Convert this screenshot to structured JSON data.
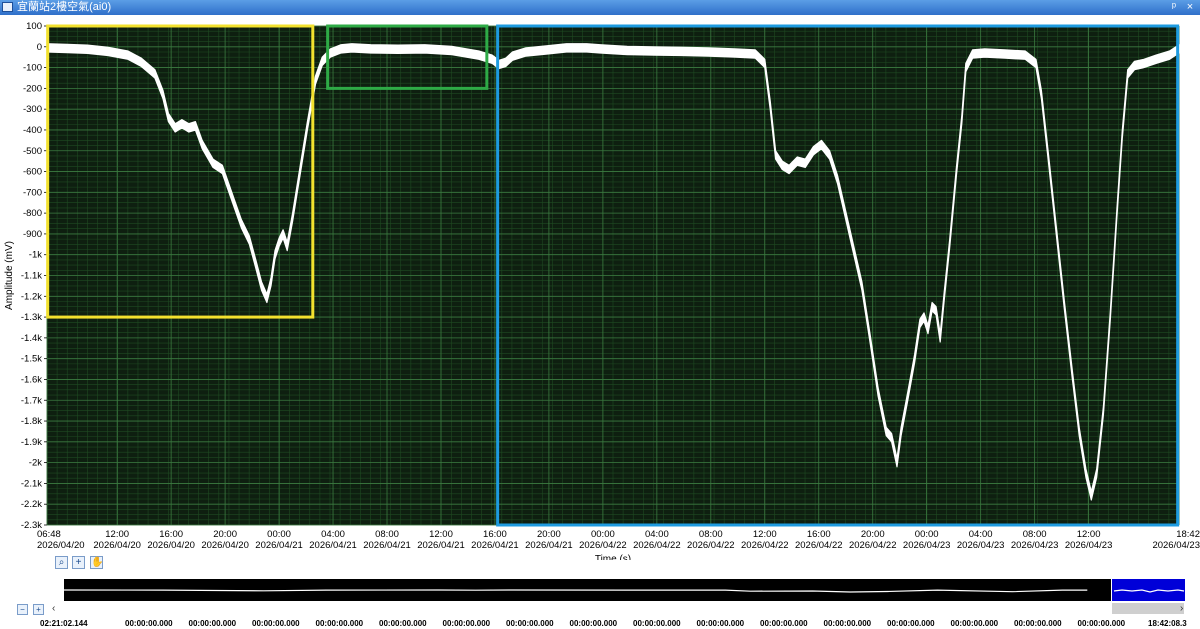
{
  "window": {
    "title": "宜蘭站2樓空氣(ai0)",
    "buttons": [
      "ᵖ",
      "×"
    ]
  },
  "chart_data": {
    "type": "line",
    "ylabel": "Amplitude (mV)",
    "xlabel": "Time (s)",
    "ylim": [
      -2300,
      100
    ],
    "yticks": [
      {
        "v": 100,
        "label": "100"
      },
      {
        "v": 0,
        "label": "0"
      },
      {
        "v": -100,
        "label": "-100"
      },
      {
        "v": -200,
        "label": "-200"
      },
      {
        "v": -300,
        "label": "-300"
      },
      {
        "v": -400,
        "label": "-400"
      },
      {
        "v": -500,
        "label": "-500"
      },
      {
        "v": -600,
        "label": "-600"
      },
      {
        "v": -700,
        "label": "-700"
      },
      {
        "v": -800,
        "label": "-800"
      },
      {
        "v": -900,
        "label": "-900"
      },
      {
        "v": -1000,
        "label": "-1k"
      },
      {
        "v": -1100,
        "label": "-1.1k"
      },
      {
        "v": -1200,
        "label": "-1.2k"
      },
      {
        "v": -1300,
        "label": "-1.3k"
      },
      {
        "v": -1400,
        "label": "-1.4k"
      },
      {
        "v": -1500,
        "label": "-1.5k"
      },
      {
        "v": -1600,
        "label": "-1.6k"
      },
      {
        "v": -1700,
        "label": "-1.7k"
      },
      {
        "v": -1800,
        "label": "-1.8k"
      },
      {
        "v": -1900,
        "label": "-1.9k"
      },
      {
        "v": -2000,
        "label": "-2k"
      },
      {
        "v": -2100,
        "label": "-2.1k"
      },
      {
        "v": -2200,
        "label": "-2.2k"
      },
      {
        "v": -2300,
        "label": "-2.3k"
      }
    ],
    "xlim_hours": [
      0,
      83.9
    ],
    "xticks": [
      {
        "h": 0,
        "time": "06:48",
        "date": "2026/04/20"
      },
      {
        "h": 5.2,
        "time": "12:00",
        "date": "2026/04/20"
      },
      {
        "h": 9.2,
        "time": "16:00",
        "date": "2026/04/20"
      },
      {
        "h": 13.2,
        "time": "20:00",
        "date": "2026/04/20"
      },
      {
        "h": 17.2,
        "time": "00:00",
        "date": "2026/04/21"
      },
      {
        "h": 21.2,
        "time": "04:00",
        "date": "2026/04/21"
      },
      {
        "h": 25.2,
        "time": "08:00",
        "date": "2026/04/21"
      },
      {
        "h": 29.2,
        "time": "12:00",
        "date": "2026/04/21"
      },
      {
        "h": 33.2,
        "time": "16:00",
        "date": "2026/04/21"
      },
      {
        "h": 37.2,
        "time": "20:00",
        "date": "2026/04/21"
      },
      {
        "h": 41.2,
        "time": "00:00",
        "date": "2026/04/22"
      },
      {
        "h": 45.2,
        "time": "04:00",
        "date": "2026/04/22"
      },
      {
        "h": 49.2,
        "time": "08:00",
        "date": "2026/04/22"
      },
      {
        "h": 53.2,
        "time": "12:00",
        "date": "2026/04/22"
      },
      {
        "h": 57.2,
        "time": "16:00",
        "date": "2026/04/22"
      },
      {
        "h": 61.2,
        "time": "20:00",
        "date": "2026/04/22"
      },
      {
        "h": 65.2,
        "time": "00:00",
        "date": "2026/04/23"
      },
      {
        "h": 69.2,
        "time": "04:00",
        "date": "2026/04/23"
      },
      {
        "h": 73.2,
        "time": "08:00",
        "date": "2026/04/23"
      },
      {
        "h": 77.2,
        "time": "12:00",
        "date": "2026/04/23"
      },
      {
        "h": 83.9,
        "time": "18:42",
        "date": "2026/04/23"
      }
    ],
    "series": [
      {
        "color": "#ffffff",
        "band_mv": 40,
        "points": [
          [
            0,
            -5
          ],
          [
            1.5,
            -8
          ],
          [
            3,
            -12
          ],
          [
            4.5,
            -22
          ],
          [
            6,
            -40
          ],
          [
            7,
            -75
          ],
          [
            8,
            -130
          ],
          [
            8.6,
            -230
          ],
          [
            9,
            -340
          ],
          [
            9.5,
            -390
          ],
          [
            10,
            -370
          ],
          [
            10.5,
            -390
          ],
          [
            11,
            -380
          ],
          [
            11.5,
            -470
          ],
          [
            12.3,
            -560
          ],
          [
            13,
            -590
          ],
          [
            13.7,
            -720
          ],
          [
            14.4,
            -850
          ],
          [
            15,
            -930
          ],
          [
            15.5,
            -1050
          ],
          [
            15.9,
            -1150
          ],
          [
            16.3,
            -1210
          ],
          [
            16.6,
            -1130
          ],
          [
            16.9,
            -1000
          ],
          [
            17.2,
            -940
          ],
          [
            17.5,
            -900
          ],
          [
            17.8,
            -960
          ],
          [
            18.2,
            -820
          ],
          [
            18.7,
            -620
          ],
          [
            19.3,
            -380
          ],
          [
            19.9,
            -160
          ],
          [
            20.4,
            -70
          ],
          [
            21,
            -30
          ],
          [
            21.8,
            -10
          ],
          [
            22.6,
            -5
          ],
          [
            24,
            -10
          ],
          [
            26,
            -12
          ],
          [
            28,
            -10
          ],
          [
            30,
            -18
          ],
          [
            32,
            -40
          ],
          [
            33,
            -60
          ],
          [
            33.5,
            -85
          ],
          [
            34,
            -75
          ],
          [
            34.5,
            -45
          ],
          [
            35.5,
            -25
          ],
          [
            37,
            -15
          ],
          [
            38.5,
            -5
          ],
          [
            40,
            -5
          ],
          [
            41,
            -10
          ],
          [
            43,
            -18
          ],
          [
            45,
            -20
          ],
          [
            47,
            -22
          ],
          [
            49,
            -25
          ],
          [
            51,
            -30
          ],
          [
            52.5,
            -35
          ],
          [
            53.2,
            -80
          ],
          [
            53.6,
            -280
          ],
          [
            54,
            -520
          ],
          [
            54.5,
            -570
          ],
          [
            55,
            -590
          ],
          [
            55.6,
            -550
          ],
          [
            56.2,
            -560
          ],
          [
            56.8,
            -500
          ],
          [
            57.4,
            -470
          ],
          [
            58,
            -520
          ],
          [
            58.6,
            -640
          ],
          [
            59.2,
            -810
          ],
          [
            59.8,
            -980
          ],
          [
            60.4,
            -1150
          ],
          [
            61,
            -1400
          ],
          [
            61.6,
            -1660
          ],
          [
            62.2,
            -1850
          ],
          [
            62.6,
            -1880
          ],
          [
            63,
            -2000
          ],
          [
            63.3,
            -1850
          ],
          [
            63.8,
            -1680
          ],
          [
            64.3,
            -1500
          ],
          [
            64.7,
            -1330
          ],
          [
            65,
            -1300
          ],
          [
            65.3,
            -1360
          ],
          [
            65.6,
            -1250
          ],
          [
            65.9,
            -1270
          ],
          [
            66.2,
            -1400
          ],
          [
            66.5,
            -1200
          ],
          [
            66.9,
            -950
          ],
          [
            67.4,
            -600
          ],
          [
            67.8,
            -350
          ],
          [
            68.1,
            -100
          ],
          [
            68.6,
            -35
          ],
          [
            69.5,
            -30
          ],
          [
            71,
            -35
          ],
          [
            72.5,
            -40
          ],
          [
            73.3,
            -80
          ],
          [
            73.7,
            -230
          ],
          [
            74.2,
            -520
          ],
          [
            74.8,
            -880
          ],
          [
            75.4,
            -1240
          ],
          [
            76,
            -1580
          ],
          [
            76.5,
            -1850
          ],
          [
            77,
            -2050
          ],
          [
            77.4,
            -2160
          ],
          [
            77.8,
            -2050
          ],
          [
            78.3,
            -1750
          ],
          [
            78.8,
            -1300
          ],
          [
            79.3,
            -800
          ],
          [
            79.7,
            -420
          ],
          [
            80.1,
            -130
          ],
          [
            80.6,
            -90
          ],
          [
            81.3,
            -80
          ],
          [
            82.2,
            -60
          ],
          [
            83.2,
            -40
          ],
          [
            83.9,
            -10
          ]
        ]
      }
    ],
    "annotation_boxes": [
      {
        "h0": 0.05,
        "h1": 19.7,
        "v0": 100,
        "v1": -1300,
        "color": "#f2e12e"
      },
      {
        "h0": 20.8,
        "h1": 32.6,
        "v0": 100,
        "v1": -200,
        "color": "#2eaa46"
      },
      {
        "h0": 33.4,
        "h1": 83.8,
        "v0": 100,
        "v1": -2300,
        "color": "#1e9be0"
      }
    ]
  },
  "toolbar": {
    "zoom_icon": "zoom-icon",
    "crosshair_icon": "crosshair-icon",
    "pan_icon": "pan-hand-icon",
    "zoom_in_icon": "zoom-in-icon",
    "zoom_out_icon": "zoom-out-icon"
  },
  "overview": {
    "selection_color": "#0000d8"
  },
  "scroll": {
    "left": "‹",
    "right": "›"
  },
  "bottom_times": [
    "02:21:02.144",
    "00:00:00.000",
    "00:00:00.000",
    "00:00:00.000",
    "00:00:00.000",
    "00:00:00.000",
    "00:00:00.000",
    "00:00:00.000",
    "00:00:00.000",
    "00:00:00.000",
    "00:00:00.000",
    "00:00:00.000",
    "00:00:00.000",
    "00:00:00.000",
    "00:00:00.000",
    "00:00:00.000",
    "00:00:00.000",
    "18:42:08.3"
  ]
}
